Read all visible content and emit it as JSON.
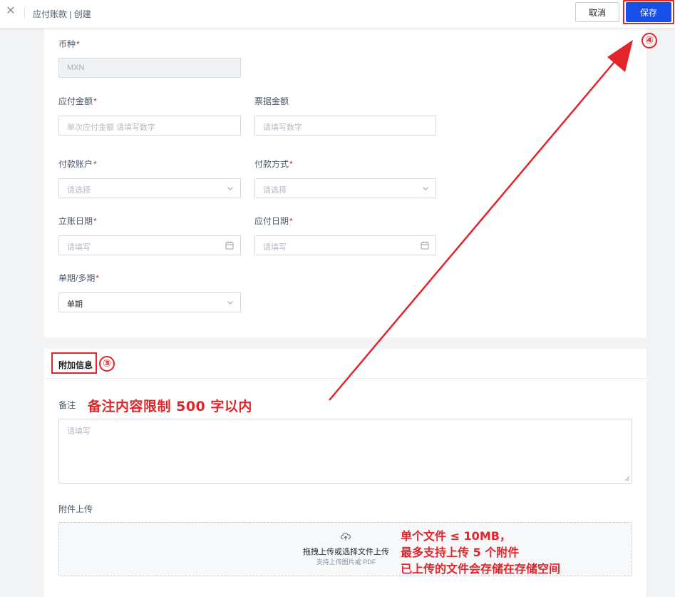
{
  "header": {
    "title": "应付账款 | 创建",
    "cancel_label": "取消",
    "save_label": "保存"
  },
  "form": {
    "currency": {
      "label": "币种",
      "value": "MXN"
    },
    "payable_amount": {
      "label": "应付金额",
      "placeholder": "单次应付金额 请填写数字"
    },
    "invoice_amount": {
      "label": "票据金额",
      "placeholder": "请填写数字"
    },
    "payment_account": {
      "label": "付款账户",
      "placeholder": "请选择"
    },
    "payment_method": {
      "label": "付款方式",
      "placeholder": "请选择"
    },
    "accounting_date": {
      "label": "立账日期",
      "placeholder": "请填写"
    },
    "due_date": {
      "label": "应付日期",
      "placeholder": "请填写"
    },
    "period_type": {
      "label": "单期/多期",
      "value": "单期"
    }
  },
  "extra": {
    "section_title": "附加信息",
    "remark": {
      "label": "备注",
      "placeholder": "请填写"
    },
    "attachment": {
      "label": "附件上传",
      "main_text": "拖拽上传或选择文件上传",
      "sub_text": "支持上传图片或 PDF"
    }
  },
  "annotations": {
    "step3": "③",
    "step4": "④",
    "remark_note": "备注内容限制 500 字以内",
    "upload_notes": [
      "单个文件 ≤ 10MB，",
      "最多支持上传 5 个附件",
      "已上传的文件会存储在存储空间"
    ],
    "color": "#e1252b"
  },
  "required_mark": "*",
  "colors": {
    "primary": "#1650e8",
    "annotation": "#e1252b"
  },
  "icons": {
    "close": "close-icon",
    "chevron": "chevron-down-icon",
    "calendar": "calendar-icon",
    "upload": "upload-cloud-icon"
  }
}
